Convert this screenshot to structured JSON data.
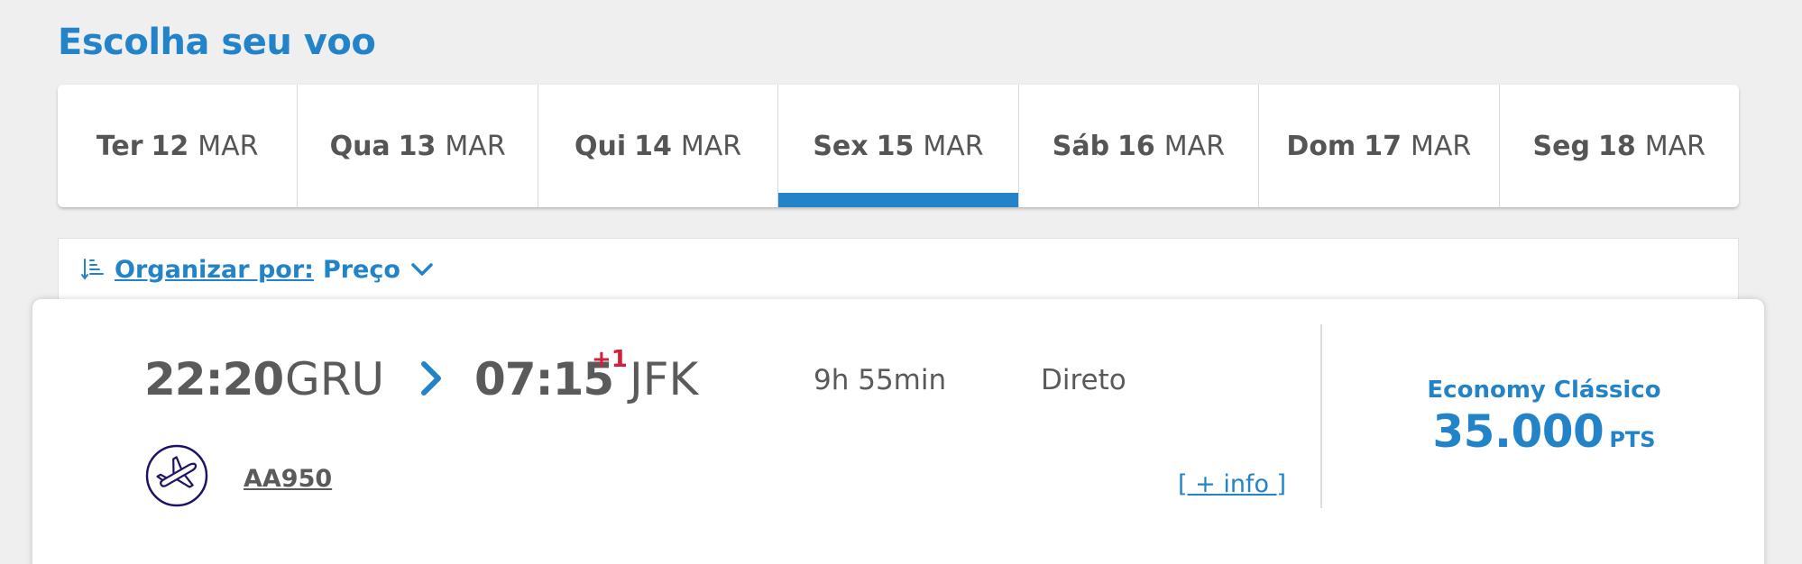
{
  "page_title": "Escolha seu voo",
  "date_tabs": [
    {
      "dow": "Ter",
      "day": "12",
      "month": "MAR",
      "active": false
    },
    {
      "dow": "Qua",
      "day": "13",
      "month": "MAR",
      "active": false
    },
    {
      "dow": "Qui",
      "day": "14",
      "month": "MAR",
      "active": false
    },
    {
      "dow": "Sex",
      "day": "15",
      "month": "MAR",
      "active": true
    },
    {
      "dow": "Sáb",
      "day": "16",
      "month": "MAR",
      "active": false
    },
    {
      "dow": "Dom",
      "day": "17",
      "month": "MAR",
      "active": false
    },
    {
      "dow": "Seg",
      "day": "18",
      "month": "MAR",
      "active": false
    }
  ],
  "sort": {
    "label": "Organizar por:",
    "value": "Preço",
    "icon": "sort-icon",
    "dropdown_icon": "chevron-down-icon"
  },
  "flight": {
    "departure_time": "22:20",
    "departure_airport": "GRU",
    "arrival_time": "07:15",
    "day_offset": "+1",
    "arrival_airport": "JFK",
    "duration": "9h 55min",
    "stops": "Direto",
    "flight_number": "AA950",
    "more_info": "[ + info ]",
    "airline_icon": "airplane-icon",
    "fare": {
      "class": "Economy Clássico",
      "points": "35.000",
      "unit": "PTS"
    }
  },
  "colors": {
    "accent": "#2283c9",
    "text": "#5a5a5a",
    "day_offset": "#d21f3c",
    "background": "#efefef",
    "airline_logo": "#1b1464"
  }
}
